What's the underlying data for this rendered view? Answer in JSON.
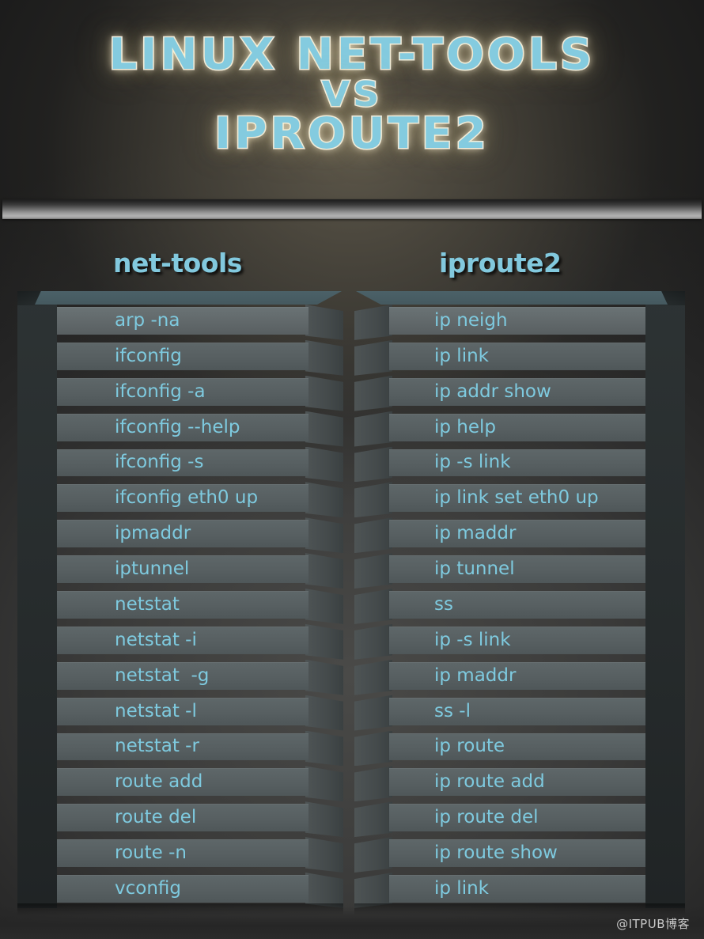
{
  "title": {
    "line1": "LINUX NET-TOOLS",
    "line2": "VS",
    "line3": "IPROUTE2"
  },
  "columns": {
    "left_header": "net-tools",
    "right_header": "iproute2"
  },
  "colors": {
    "accent_blue": "#7ecadf",
    "title_blue": "#84cbdf",
    "title_outline": "#f2f2ee",
    "glow": "#fff4d6",
    "row_face": "#596264",
    "pedestal_side": "#2d3334",
    "cap_strip": "#4b6168",
    "background_center": "#5a574f",
    "background_edge": "#1b1b1b",
    "watermark": "#c9c9c9"
  },
  "rows": [
    {
      "net_tools": "arp -na",
      "iproute2": "ip neigh"
    },
    {
      "net_tools": "ifconfig",
      "iproute2": "ip link"
    },
    {
      "net_tools": "ifconfig -a",
      "iproute2": "ip addr show"
    },
    {
      "net_tools": "ifconfig --help",
      "iproute2": "ip help"
    },
    {
      "net_tools": "ifconfig -s",
      "iproute2": "ip -s link"
    },
    {
      "net_tools": "ifconfig eth0 up",
      "iproute2": "ip link set eth0 up"
    },
    {
      "net_tools": "ipmaddr",
      "iproute2": "ip maddr"
    },
    {
      "net_tools": "iptunnel",
      "iproute2": "ip tunnel"
    },
    {
      "net_tools": "netstat",
      "iproute2": "ss"
    },
    {
      "net_tools": "netstat -i",
      "iproute2": "ip -s link"
    },
    {
      "net_tools": "netstat  -g",
      "iproute2": "ip maddr"
    },
    {
      "net_tools": "netstat -l",
      "iproute2": "ss -l"
    },
    {
      "net_tools": "netstat -r",
      "iproute2": "ip route"
    },
    {
      "net_tools": "route add",
      "iproute2": "ip route add"
    },
    {
      "net_tools": "route del",
      "iproute2": "ip route del"
    },
    {
      "net_tools": "route -n",
      "iproute2": "ip route show"
    },
    {
      "net_tools": "vconfig",
      "iproute2": "ip link"
    }
  ],
  "watermark": "@ITPUB博客"
}
